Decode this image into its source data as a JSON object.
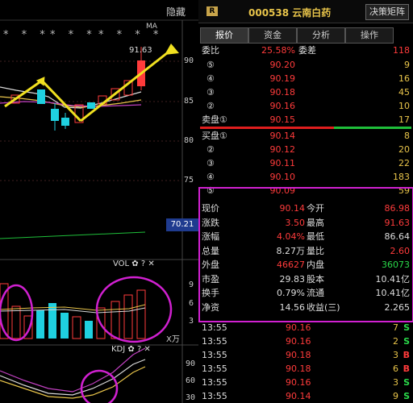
{
  "left_panel": {
    "hide_button": "隐藏",
    "stars": [
      "* * *",
      "* * *",
      "* * * *"
    ],
    "ma_label": "MA",
    "price_callout": "91.63",
    "price_ticks": [
      "90",
      "85",
      "80",
      "75"
    ],
    "last_price_tag": "70.21",
    "vol_label": "VOL ✿ ? ✕",
    "vol_ticks": [
      "9",
      "6",
      "3"
    ],
    "vol_unit": "X万",
    "kdj_label": "KDJ ✿ ? ✕",
    "kdj_ticks": [
      "90",
      "60",
      "30"
    ]
  },
  "header": {
    "badge": "R",
    "title": "000538 云南白药",
    "matrix_button": "决策矩阵"
  },
  "tabs": [
    "报价",
    "资金",
    "分析",
    "操作"
  ],
  "ratio_row": {
    "label": "委比",
    "ratio": "25.58%",
    "diff_label": "委差",
    "diff": "118"
  },
  "asks": [
    {
      "label": "⑤",
      "price": "90.20",
      "vol": "9"
    },
    {
      "label": "④",
      "price": "90.19",
      "vol": "16"
    },
    {
      "label": "③",
      "price": "90.18",
      "vol": "45"
    },
    {
      "label": "②",
      "price": "90.16",
      "vol": "10"
    },
    {
      "label": "卖盘①",
      "price": "90.15",
      "vol": "17"
    }
  ],
  "bids": [
    {
      "label": "买盘①",
      "price": "90.14",
      "vol": "8"
    },
    {
      "label": "②",
      "price": "90.12",
      "vol": "20"
    },
    {
      "label": "③",
      "price": "90.11",
      "vol": "22"
    },
    {
      "label": "④",
      "price": "90.10",
      "vol": "183"
    },
    {
      "label": "⑤",
      "price": "90.09",
      "vol": "59"
    }
  ],
  "stats": [
    {
      "k1": "现价",
      "v1": "90.14",
      "c1": "red",
      "k2": "今开",
      "v2": "86.98",
      "c2": "red"
    },
    {
      "k1": "涨跌",
      "v1": "3.50",
      "c1": "red",
      "k2": "最高",
      "v2": "91.63",
      "c2": "red"
    },
    {
      "k1": "涨幅",
      "v1": "4.04%",
      "c1": "red",
      "k2": "最低",
      "v2": "86.64",
      "c2": "white"
    },
    {
      "k1": "总量",
      "v1": "8.27万",
      "c1": "white",
      "k2": "量比",
      "v2": "2.60",
      "c2": "red"
    },
    {
      "k1": "外盘",
      "v1": "46627",
      "c1": "red",
      "k2": "内盘",
      "v2": "36073",
      "c2": "green"
    },
    {
      "k1": "市盈",
      "v1": "29.83",
      "c1": "white",
      "k2": "股本",
      "v2": "10.41亿",
      "c2": "white"
    },
    {
      "k1": "换手",
      "v1": "0.79%",
      "c1": "white",
      "k2": "流通",
      "v2": "10.41亿",
      "c2": "white"
    },
    {
      "k1": "净资",
      "v1": "14.56",
      "c1": "white",
      "k2": "收益(三)",
      "v2": "2.265",
      "c2": "white"
    }
  ],
  "ticks": [
    {
      "time": "13:55",
      "price": "90.16",
      "vol": "7",
      "dir": "S",
      "dcolor": "#2ad94a"
    },
    {
      "time": "13:55",
      "price": "90.16",
      "vol": "2",
      "dir": "S",
      "dcolor": "#2ad94a"
    },
    {
      "time": "13:55",
      "price": "90.18",
      "vol": "3",
      "dir": "B",
      "dcolor": "#ff3b3b"
    },
    {
      "time": "13:55",
      "price": "90.18",
      "vol": "6",
      "dir": "B",
      "dcolor": "#ff3b3b"
    },
    {
      "time": "13:55",
      "price": "90.16",
      "vol": "3",
      "dir": "S",
      "dcolor": "#2ad94a"
    },
    {
      "time": "13:55",
      "price": "90.14",
      "vol": "9",
      "dir": "S",
      "dcolor": "#2ad94a"
    }
  ],
  "colors": {
    "up": "#ff3b3b",
    "down": "#2ad94a",
    "annotation": "#d020d0",
    "arrow": "#f0e020"
  }
}
